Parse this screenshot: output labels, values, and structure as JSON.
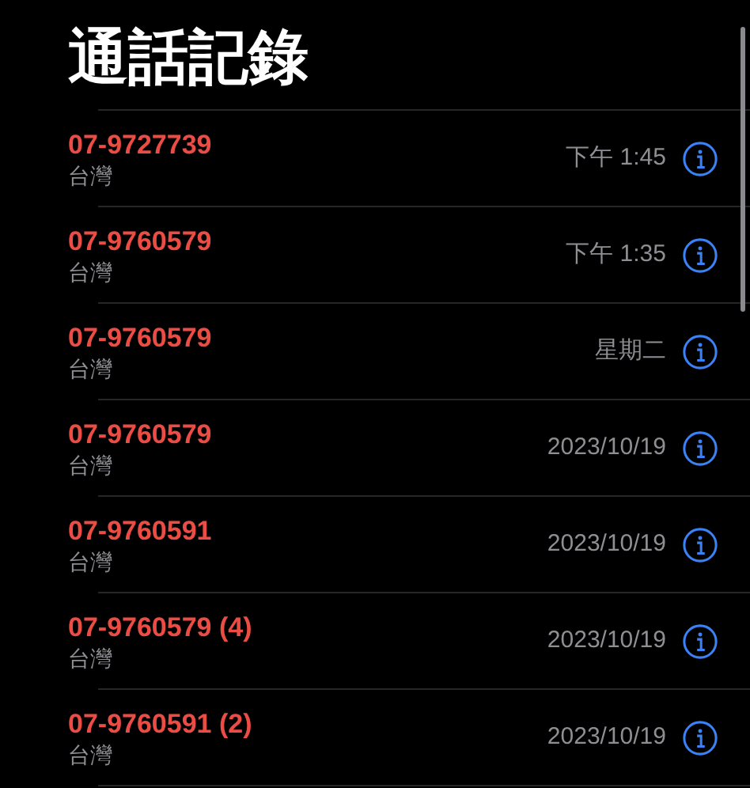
{
  "title": "通話記錄",
  "calls": [
    {
      "number": "07-9727739",
      "label": "台灣",
      "time": "下午 1:45",
      "missed": true
    },
    {
      "number": "07-9760579",
      "label": "台灣",
      "time": "下午 1:35",
      "missed": true
    },
    {
      "number": "07-9760579",
      "label": "台灣",
      "time": "星期二",
      "missed": true
    },
    {
      "number": "07-9760579",
      "label": "台灣",
      "time": "2023/10/19",
      "missed": true
    },
    {
      "number": "07-9760591",
      "label": "台灣",
      "time": "2023/10/19",
      "missed": true
    },
    {
      "number": "07-9760579 (4)",
      "label": "台灣",
      "time": "2023/10/19",
      "missed": true
    },
    {
      "number": "07-9760591 (2)",
      "label": "台灣",
      "time": "2023/10/19",
      "missed": true
    }
  ]
}
